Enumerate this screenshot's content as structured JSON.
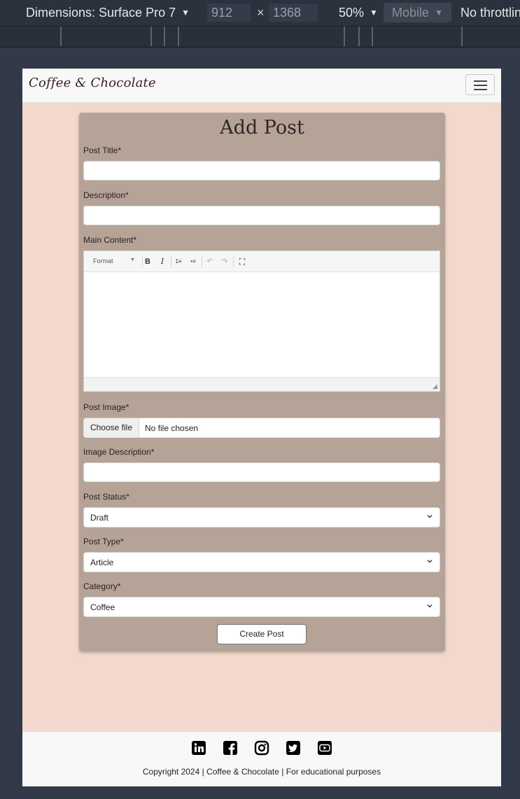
{
  "devtools": {
    "dimensions_label": "Dimensions: Surface Pro 7",
    "width_value": "912",
    "times_symbol": "×",
    "height_value": "1368",
    "zoom": "50%",
    "mode": "Mobile",
    "throttling": "No throttling",
    "caret": "▼"
  },
  "navbar": {
    "brand": "Coffee & Chocolate",
    "toggler_icon": "hamburger-icon"
  },
  "form": {
    "heading": "Add Post",
    "title_label": "Post Title*",
    "description_label": "Description*",
    "content_label": "Main Content*",
    "editor": {
      "format_label": "Format",
      "bold": "B",
      "italic": "I",
      "ordered_list": "1≡",
      "bullet_list": "•≡",
      "undo": "↶",
      "redo": "↷",
      "fullscreen": "⛶"
    },
    "image_label": "Post Image*",
    "file_button": "Choose file",
    "file_status": "No file chosen",
    "image_description_label": "Image Description*",
    "status_label": "Post Status*",
    "status_value": "Draft",
    "type_label": "Post Type*",
    "type_value": "Article",
    "category_label": "Category*",
    "category_value": "Coffee",
    "submit_label": "Create Post"
  },
  "footer": {
    "social_icons": [
      "linkedin-icon",
      "facebook-icon",
      "instagram-icon",
      "twitter-icon",
      "youtube-icon"
    ],
    "copyright": "Copyright 2024 | Coffee & Chocolate | For educational purposes"
  },
  "colors": {
    "page_bg": "#f3d9cd",
    "card_bg": "#b5a397",
    "devtools_bg": "#323a4a"
  }
}
